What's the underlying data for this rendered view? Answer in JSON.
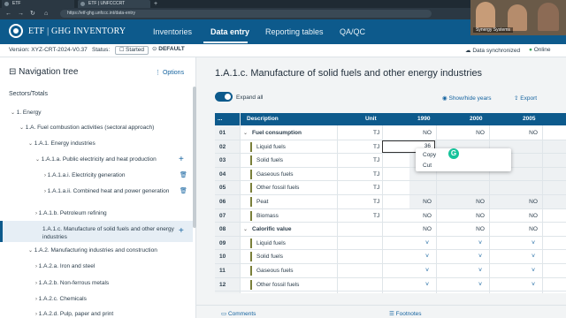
{
  "browser": {
    "tabs": [
      {
        "label": "ETF"
      },
      {
        "label": "ETF | UNFCCCRT"
      }
    ],
    "new_tab": "+",
    "url": "https://etf-ghg.unfccc.int/data-entry"
  },
  "header": {
    "logo_text": "ETF | GHG INVENTORY",
    "nav": [
      {
        "label": "Inventories"
      },
      {
        "label": "Data entry"
      },
      {
        "label": "Reporting tables"
      },
      {
        "label": "QA/QC"
      }
    ],
    "video_label": "Synergy Systems"
  },
  "version_bar": {
    "version": "Version: XYZ-CRT-2024-V0.37",
    "status_label": "Status:",
    "status_value": "Started",
    "default_badge": "DEFAULT",
    "sync_status": "Data synchronized",
    "online": "Online"
  },
  "nav_tree": {
    "title": "Navigation tree",
    "options": "Options",
    "section": "Sectors/Totals",
    "items": [
      {
        "label": "1.  Energy"
      },
      {
        "label": "1.A. Fuel combustion activities (sectoral approach)"
      },
      {
        "label": "1.A.1. Energy industries"
      },
      {
        "label": "1.A.1.a. Public electricity and heat production"
      },
      {
        "label": "1.A.1.a.i. Electricity generation"
      },
      {
        "label": "1.A.1.a.ii. Combined heat and power generation"
      },
      {
        "label": "1.A.1.b. Petroleum refining"
      },
      {
        "label": "1.A.1.c. Manufacture of solid fuels and other energy industries"
      },
      {
        "label": "1.A.2. Manufacturing industries and construction"
      },
      {
        "label": "1.A.2.a. Iron and steel"
      },
      {
        "label": "1.A.2.b. Non-ferrous metals"
      },
      {
        "label": "1.A.2.c. Chemicals"
      },
      {
        "label": "1.A.2.d. Pulp, paper and print"
      }
    ]
  },
  "main": {
    "title": "1.A.1.c. Manufacture of solid fuels and other energy industries",
    "expand_all": "Expand all",
    "show_hide_years": "Show/hide years",
    "export": "Export",
    "table": {
      "headers": {
        "menu": "...",
        "description": "Description",
        "unit": "Unit",
        "years": [
          "1990",
          "2000",
          "2005"
        ]
      },
      "rows": [
        {
          "num": "01",
          "desc": "Fuel consumption",
          "unit": "TJ",
          "vals": [
            "NO",
            "NO",
            "NO"
          ]
        },
        {
          "num": "02",
          "desc": "Liquid fuels",
          "unit": "TJ",
          "vals": [
            "",
            "",
            ""
          ]
        },
        {
          "num": "03",
          "desc": "Solid fuels",
          "unit": "TJ",
          "vals": [
            "",
            "",
            ""
          ]
        },
        {
          "num": "04",
          "desc": "Gaseous fuels",
          "unit": "TJ",
          "vals": [
            "",
            "",
            ""
          ]
        },
        {
          "num": "05",
          "desc": "Other fossil fuels",
          "unit": "TJ",
          "vals": [
            "",
            "",
            ""
          ]
        },
        {
          "num": "06",
          "desc": "Peat",
          "unit": "TJ",
          "vals": [
            "NO",
            "NO",
            "NO"
          ]
        },
        {
          "num": "07",
          "desc": "Biomass",
          "unit": "TJ",
          "vals": [
            "NO",
            "NO",
            "NO"
          ]
        },
        {
          "num": "08",
          "desc": "Calorific value",
          "unit": "",
          "vals": [
            "NO",
            "NO",
            "NO"
          ]
        },
        {
          "num": "09",
          "desc": "Liquid fuels",
          "unit": "",
          "vals": [
            "˅",
            "˅",
            "˅"
          ]
        },
        {
          "num": "10",
          "desc": "Solid fuels",
          "unit": "",
          "vals": [
            "˅",
            "˅",
            "˅"
          ]
        },
        {
          "num": "11",
          "desc": "Gaseous fuels",
          "unit": "",
          "vals": [
            "˅",
            "˅",
            "˅"
          ]
        },
        {
          "num": "12",
          "desc": "Other fossil fuels",
          "unit": "",
          "vals": [
            "˅",
            "˅",
            "˅"
          ]
        }
      ],
      "edit_value": "36"
    },
    "context_menu": {
      "items": [
        {
          "label": "Copy"
        },
        {
          "label": "Cut"
        }
      ]
    },
    "bottom": {
      "comments": "Comments",
      "footnotes": "Footnotes"
    }
  }
}
